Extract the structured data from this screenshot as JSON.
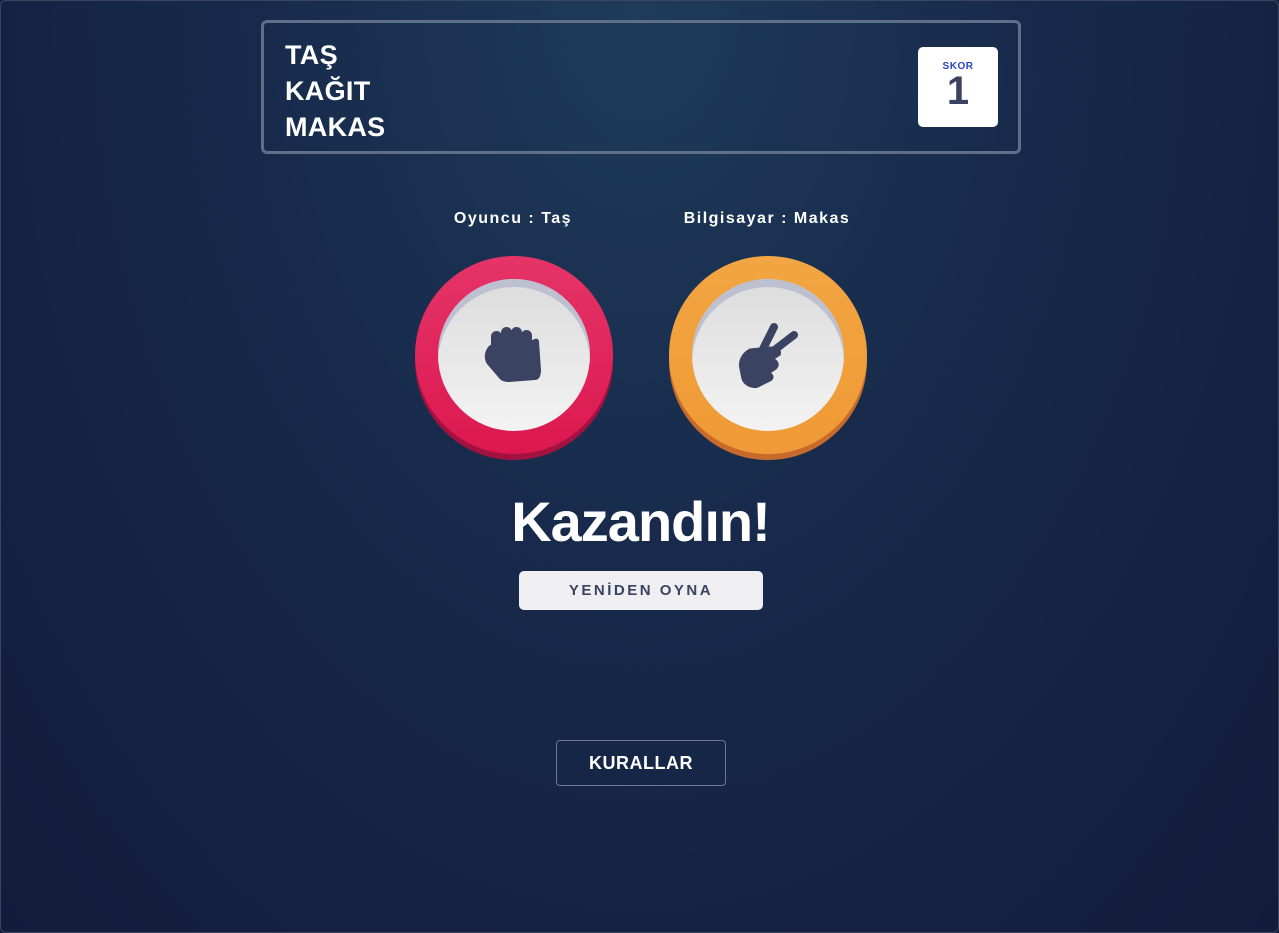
{
  "header": {
    "title_lines": [
      "TAŞ",
      "KAĞIT",
      "MAKAS"
    ],
    "score_label": "SKOR",
    "score_value": "1"
  },
  "game": {
    "player_label": "Oyuncu : Taş",
    "cpu_label": "Bilgisayar : Makas",
    "player_icon": "rock-fist-icon",
    "cpu_icon": "scissors-hand-icon",
    "result": "Kazandın!",
    "play_again_label": "YENİDEN OYNA"
  },
  "footer": {
    "rules_label": "KURALLAR"
  },
  "colors": {
    "rock_ring": "#dc1850",
    "scissors_ring": "#ee9a36",
    "background": "#17294a",
    "icon": "#3b4363"
  }
}
